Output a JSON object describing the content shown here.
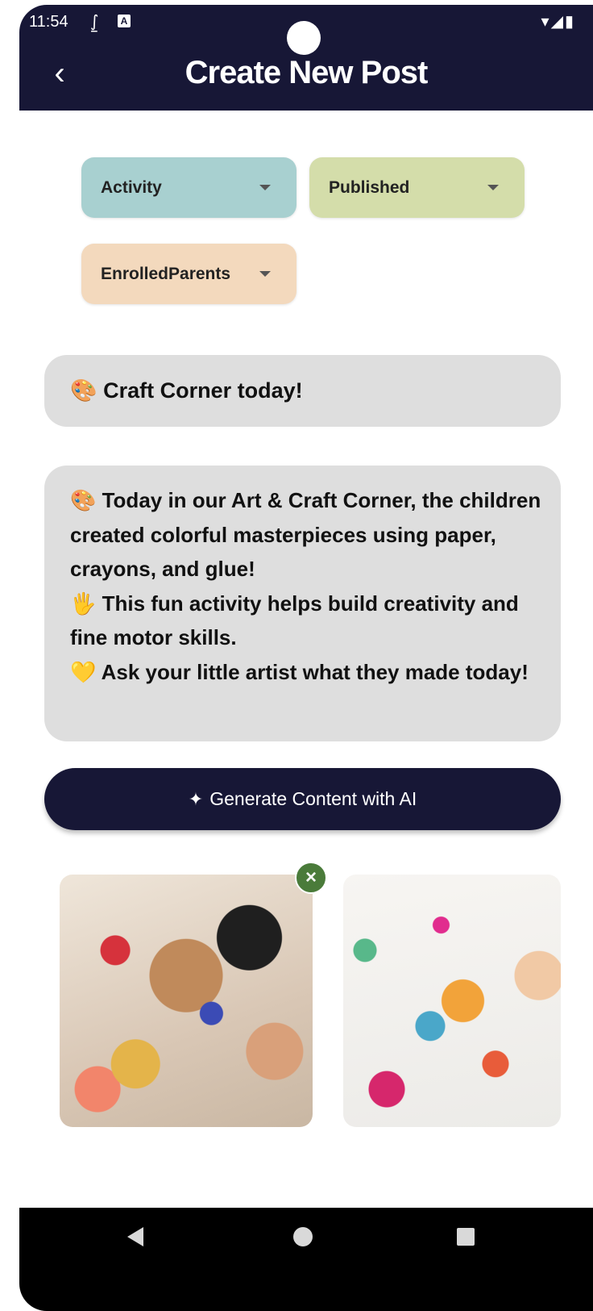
{
  "status_bar": {
    "time": "11:54",
    "left_icons": [
      "notification-icon",
      "app-icon"
    ],
    "right_icons": [
      "wifi-icon",
      "signal-icon",
      "battery-icon"
    ]
  },
  "header": {
    "title": "Create New Post",
    "back_icon": "chevron-left-icon",
    "background": "#171736"
  },
  "dropdowns": {
    "type": {
      "value": "Activity",
      "color": "#a8d0d0"
    },
    "status": {
      "value": "Published",
      "color": "#d4ddaa"
    },
    "audience": {
      "value": "EnrolledParents",
      "color": "#f3d9bd"
    }
  },
  "post": {
    "title": "🎨 Craft Corner today!",
    "body": [
      "🎨 Today in our Art & Craft Corner, the children created colorful masterpieces using paper, crayons, and glue!",
      "🖐 This fun activity helps build creativity and fine motor skills.",
      "💛 Ask your little artist what they made today!"
    ]
  },
  "ai_button": {
    "label": "Generate Content with AI",
    "icon": "sparkle-icon"
  },
  "images": [
    {
      "name": "craft-table-photo",
      "removable": true
    },
    {
      "name": "child-drawing-photo",
      "removable": false
    }
  ],
  "nav_bar": {
    "icons": [
      "back-triangle-icon",
      "home-circle-icon",
      "recents-square-icon"
    ]
  }
}
